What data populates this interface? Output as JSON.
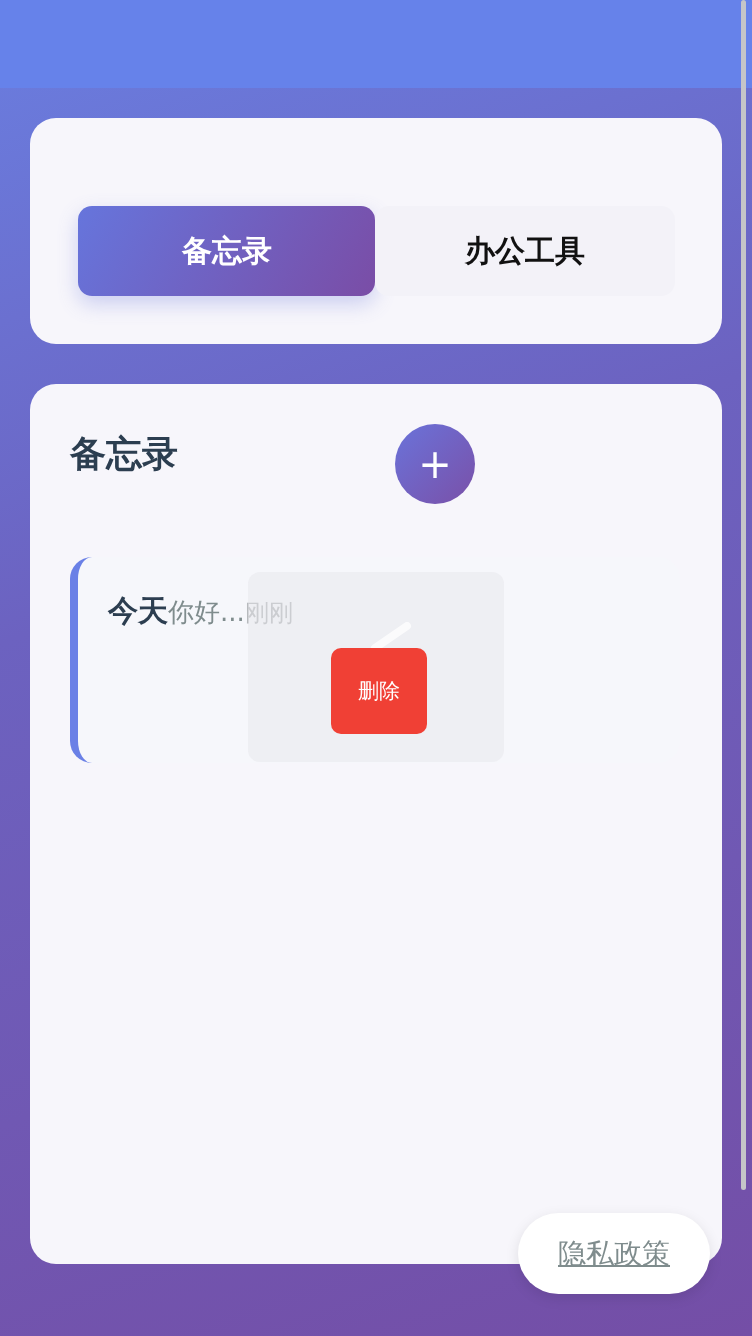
{
  "tabs": [
    {
      "label": "备忘录",
      "selected": true
    },
    {
      "label": "办公工具",
      "selected": false
    }
  ],
  "memo": {
    "title": "备忘录",
    "add_button": "+",
    "notes": [
      {
        "title": "今天",
        "preview": "你好...",
        "time": "刚刚"
      }
    ]
  },
  "toast": {
    "kind": "success"
  },
  "delete_button": "删除",
  "privacy_link": "隐私政策"
}
